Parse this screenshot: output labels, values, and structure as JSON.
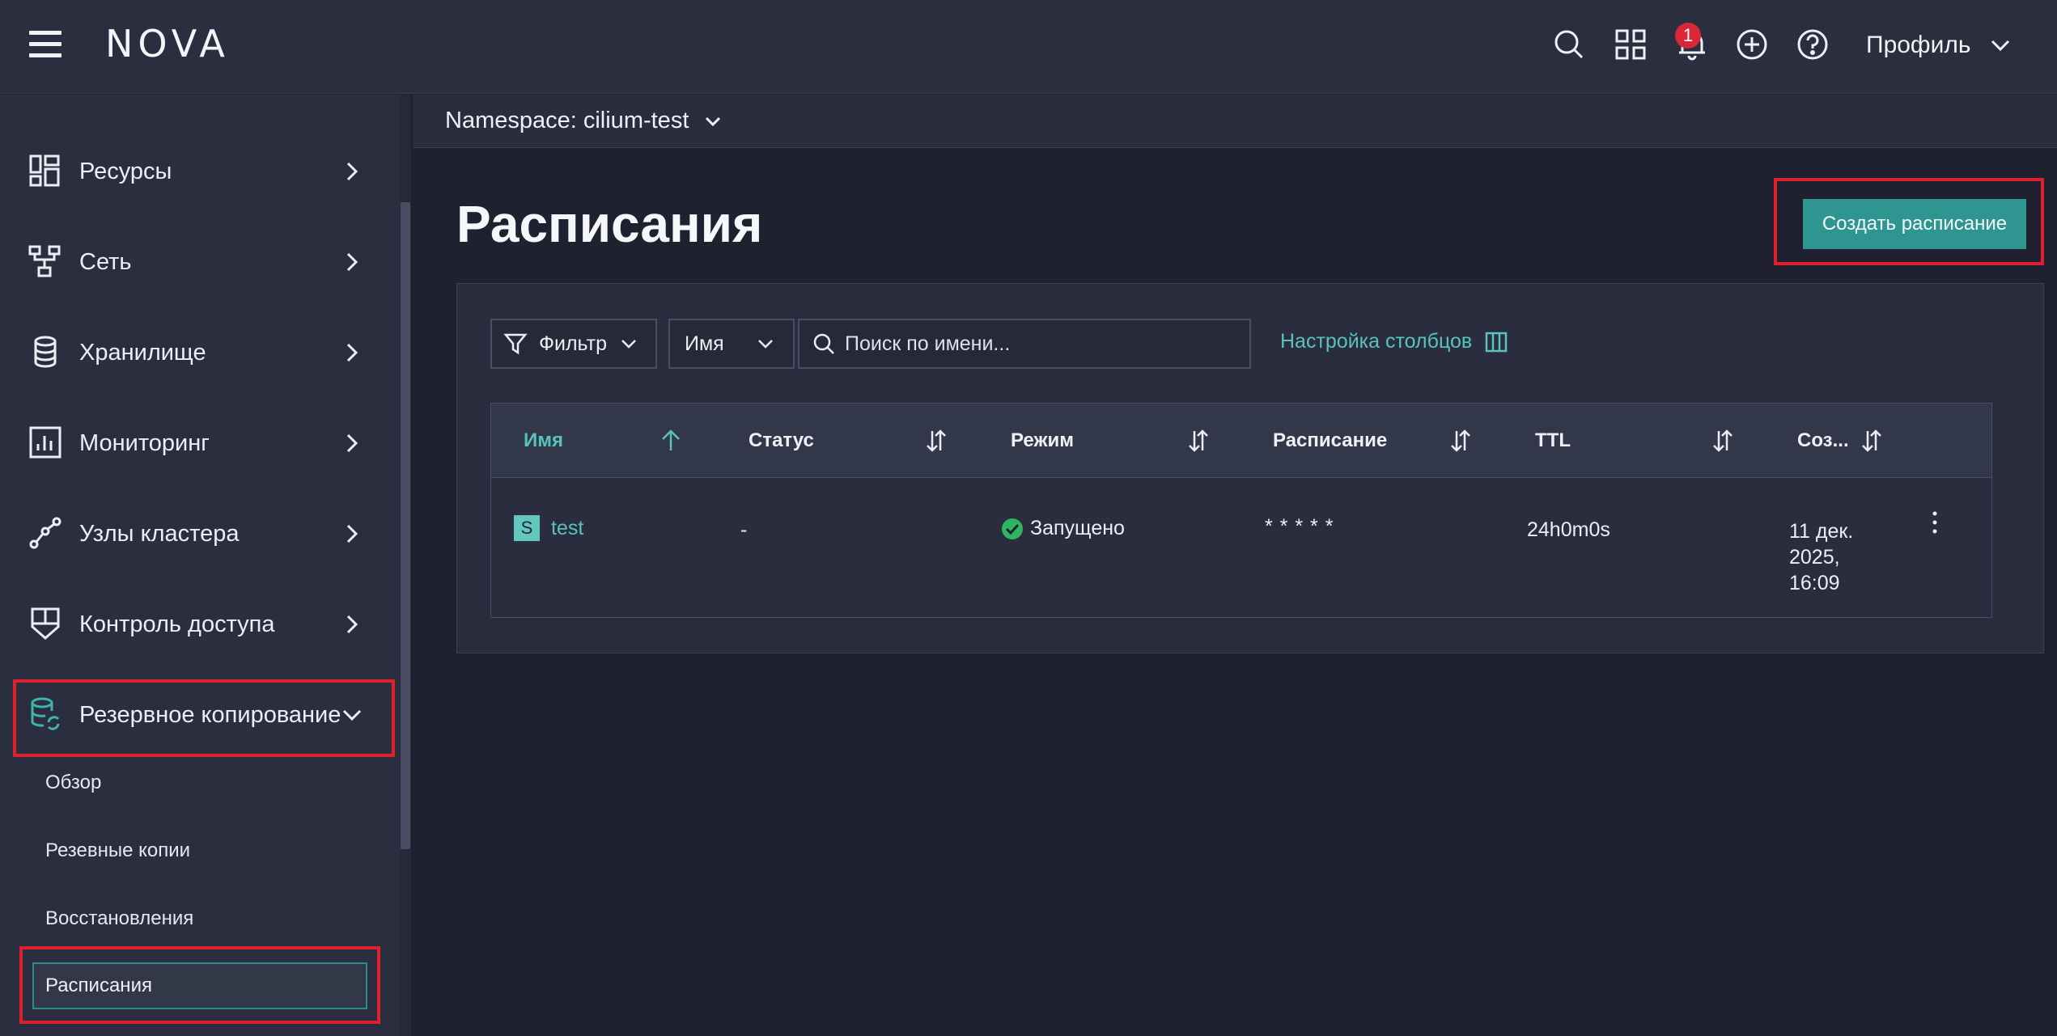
{
  "header": {
    "logo": "NOVA",
    "notification_count": "1",
    "profile_label": "Профиль",
    "icons": [
      "menu-icon",
      "search-icon",
      "apps-grid-icon",
      "bell-icon",
      "add-circle-icon",
      "help-icon",
      "chevron-down-icon"
    ]
  },
  "sidebar": {
    "items": [
      {
        "label": "Ресурсы",
        "icon": "resources-icon"
      },
      {
        "label": "Сеть",
        "icon": "network-icon"
      },
      {
        "label": "Хранилище",
        "icon": "storage-icon"
      },
      {
        "label": "Мониторинг",
        "icon": "monitoring-icon"
      },
      {
        "label": "Узлы кластера",
        "icon": "cluster-nodes-icon"
      },
      {
        "label": "Контроль доступа",
        "icon": "access-control-icon"
      },
      {
        "label": "Резервное копирование",
        "icon": "backup-icon"
      }
    ],
    "submenu": [
      {
        "label": "Обзор"
      },
      {
        "label": "Резевные копии"
      },
      {
        "label": "Восстановления"
      },
      {
        "label": "Расписания"
      }
    ]
  },
  "namespace": {
    "label": "Namespace: cilium-test"
  },
  "main": {
    "title": "Расписания",
    "create_button": "Создать расписание",
    "filter_label": "Фильтр",
    "name_select": "Имя",
    "search_placeholder": "Поиск по имени...",
    "column_settings": "Настройка столбцов"
  },
  "table": {
    "columns": [
      {
        "label": "Имя"
      },
      {
        "label": "Статус"
      },
      {
        "label": "Режим"
      },
      {
        "label": "Расписание"
      },
      {
        "label": "TTL"
      },
      {
        "label": "Соз..."
      }
    ],
    "rows": [
      {
        "badge": "S",
        "name": "test",
        "status": "-",
        "mode": "Запущено",
        "schedule": "* * * * *",
        "ttl": "24h0m0s",
        "created_line1": "11 дек.",
        "created_line2": "2025,",
        "created_line3": "16:09"
      }
    ]
  },
  "colors": {
    "accent": "#2e9591",
    "link": "#58c2bd",
    "highlight_border": "#e0202e",
    "badge_red": "#d9273a",
    "status_ok": "#2fb560"
  }
}
